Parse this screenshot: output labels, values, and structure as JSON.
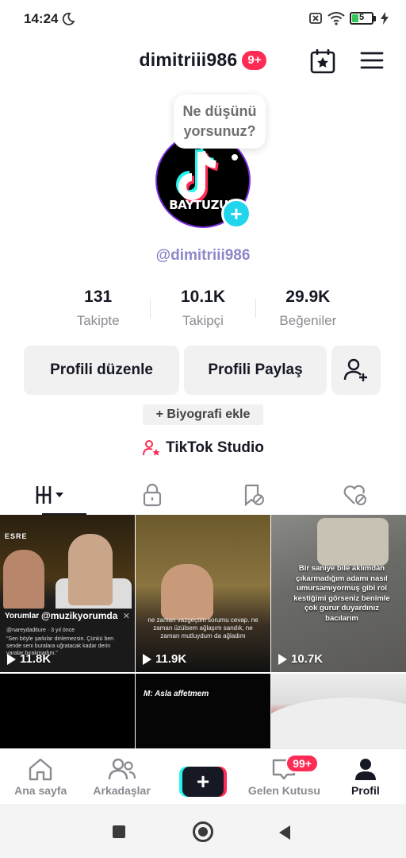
{
  "status_bar": {
    "time": "14:24",
    "battery_level": "5",
    "icons": [
      "moon-icon",
      "sim-off-icon",
      "wifi-icon",
      "battery-icon",
      "charging-bolt-icon"
    ]
  },
  "header": {
    "username": "dimitriii986",
    "notification_badge": "9+",
    "icons": [
      "calendar-star-icon",
      "menu-icon"
    ]
  },
  "profile": {
    "bubble_line1": "Ne düşünü",
    "bubble_line2": "yorsunuz?",
    "avatar_text": "BAYTUZUK",
    "handle": "@dimitriii986",
    "stats": [
      {
        "value": "131",
        "label": "Takipte"
      },
      {
        "value": "10.1K",
        "label": "Takipçi"
      },
      {
        "value": "29.9K",
        "label": "Beğeniler"
      }
    ],
    "edit_button": "Profili düzenle",
    "share_button": "Profili Paylaş",
    "add_bio": "+ Biyografi ekle",
    "studio": "TikTok Studio"
  },
  "tabs": [
    {
      "name": "videos",
      "icon": "grid-icon",
      "active": true
    },
    {
      "name": "private",
      "icon": "lock-icon",
      "active": false
    },
    {
      "name": "reposts",
      "icon": "repost-hidden-icon",
      "active": false
    },
    {
      "name": "liked",
      "icon": "heart-hidden-icon",
      "active": false
    }
  ],
  "videos": [
    {
      "views": "11.8K",
      "overlay_logo": "ESRE",
      "comments_title": "Yorumlar",
      "tag": "@muzikyorumda",
      "comment_user": "@nareydaditure · 3 yıl önce",
      "comment_text": "\"Sen böyle şarkılar dinlemezsin. Çünkü ben sende seni buralara uğratacak kadar derin yaralar bırakmadım.\""
    },
    {
      "views": "11.9K",
      "caption": "ne zaman vazgeçtim sorumu cevap. ne zaman üzülsem ağlaşım sandık, ne zaman mutluydum da ağladım"
    },
    {
      "views": "10.7K",
      "caption": "Bir saniye bile aklımdan çıkarmadığım adamı nasıl umursamıyormuş gibi rol kestiğimi görseniz benimle çok gurur duyardınız bacılarım"
    },
    {
      "views": ""
    },
    {
      "views": "",
      "caption": "M: Asla affetmem"
    },
    {
      "views": ""
    }
  ],
  "bottom_nav": [
    {
      "label": "Ana sayfa",
      "icon": "home-icon",
      "active": false
    },
    {
      "label": "Arkadaşlar",
      "icon": "friends-icon",
      "active": false
    },
    {
      "label": "",
      "icon": "plus-icon",
      "active": false
    },
    {
      "label": "Gelen Kutusu",
      "icon": "inbox-icon",
      "active": false,
      "badge": "99+"
    },
    {
      "label": "Profil",
      "icon": "profile-icon",
      "active": true
    }
  ],
  "colors": {
    "accent_red": "#fe2c55",
    "accent_cyan": "#25f4ee",
    "handle_purple": "#8b87c9",
    "text_primary": "#161823",
    "text_secondary": "#8a8b91"
  }
}
